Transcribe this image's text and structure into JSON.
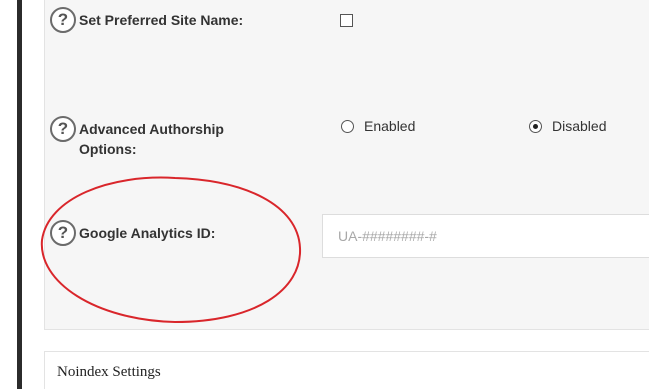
{
  "fields": {
    "preferred_site_name": {
      "label": "Set Preferred Site Name:",
      "checked": false
    },
    "advanced_authorship": {
      "label_line1": "Advanced Authorship",
      "label_line2": "Options:",
      "options": [
        {
          "label": "Enabled",
          "selected": false
        },
        {
          "label": "Disabled",
          "selected": true
        }
      ]
    },
    "google_analytics": {
      "label": "Google Analytics ID:",
      "value": "",
      "placeholder": "UA-########-#"
    }
  },
  "help_icon": {
    "glyph": "?",
    "icon": "question-circle-icon"
  },
  "noindex_section": {
    "title": "Noindex Settings"
  },
  "annotation": {
    "shape": "ellipse",
    "color": "#d9262b",
    "target": "google_analytics"
  }
}
